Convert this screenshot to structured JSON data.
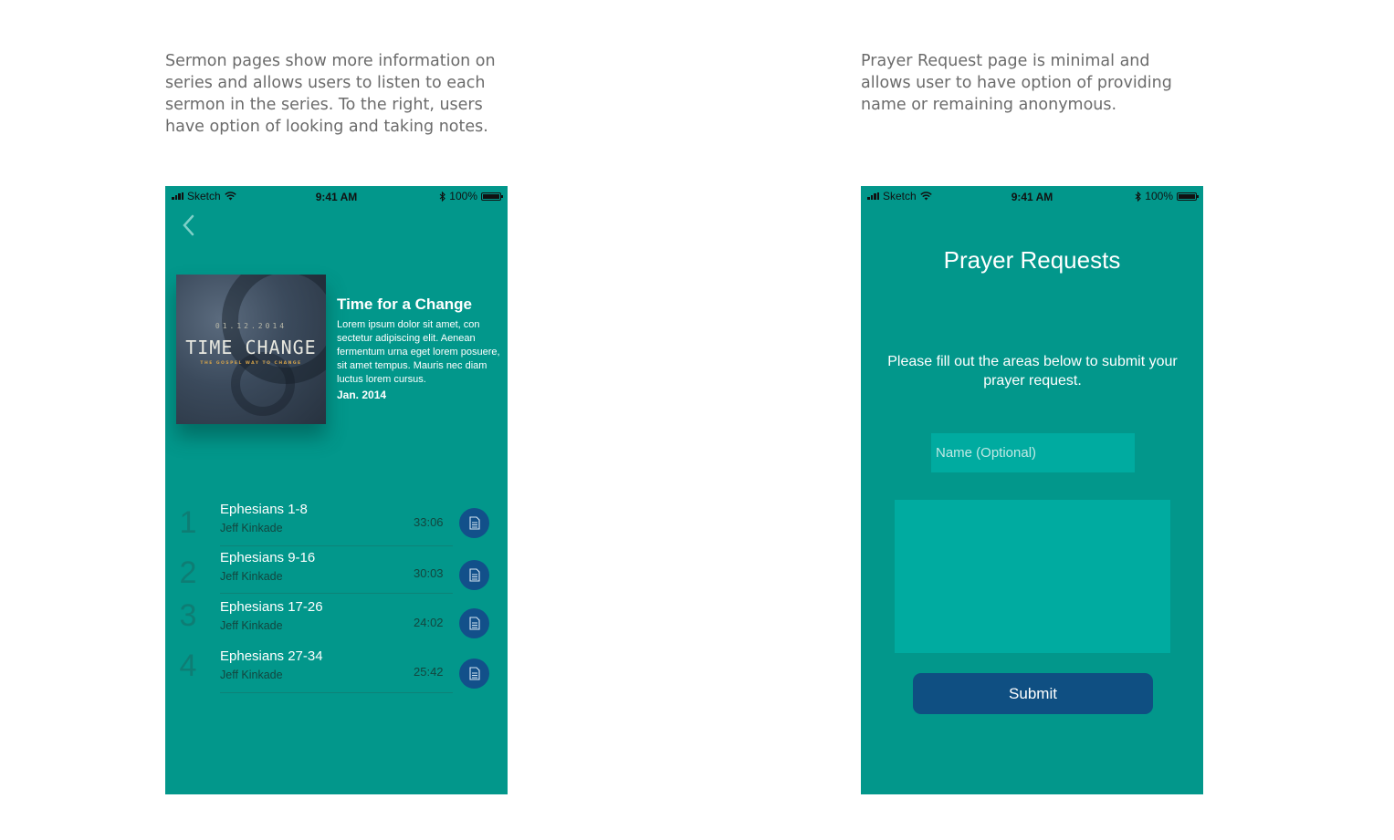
{
  "captions": {
    "left": "Sermon pages show more information on series and allows users to listen to each sermon in the series. To the right, users have option of looking and taking notes.",
    "right": "Prayer Request page is minimal and allows user to have option of providing name or remaining anonymous."
  },
  "status_bar": {
    "carrier": "Sketch",
    "time": "9:41 AM",
    "battery": "100%"
  },
  "sermon": {
    "cover": {
      "date": "01.12.2014",
      "title": "TIME CHANGE",
      "subtitle": "THE GOSPEL WAY TO CHANGE"
    },
    "series_title": "Time for a Change",
    "description": "Lorem ipsum dolor sit amet, con sectetur adipiscing elit. Aenean fermentum urna eget lorem posuere, sit amet tempus. Mauris nec diam luctus lorem cursus.",
    "date": "Jan. 2014",
    "episodes": [
      {
        "number": "1",
        "title": "Ephesians 1-8",
        "author": "Jeff Kinkade",
        "duration": "33:06"
      },
      {
        "number": "2",
        "title": "Ephesians 9-16",
        "author": "Jeff Kinkade",
        "duration": "30:03"
      },
      {
        "number": "3",
        "title": "Ephesians 17-26",
        "author": "Jeff Kinkade",
        "duration": "24:02"
      },
      {
        "number": "4",
        "title": "Ephesians 27-34",
        "author": "Jeff Kinkade",
        "duration": "25:42"
      }
    ]
  },
  "prayer": {
    "title": "Prayer Requests",
    "instructions": "Please fill out the areas below to submit your prayer request.",
    "name_placeholder": "Name (Optional)",
    "request_value": "",
    "submit_label": "Submit"
  },
  "colors": {
    "teal_background": "#02978b",
    "field_teal": "#00aba0",
    "navy_button": "#0f4f82"
  }
}
